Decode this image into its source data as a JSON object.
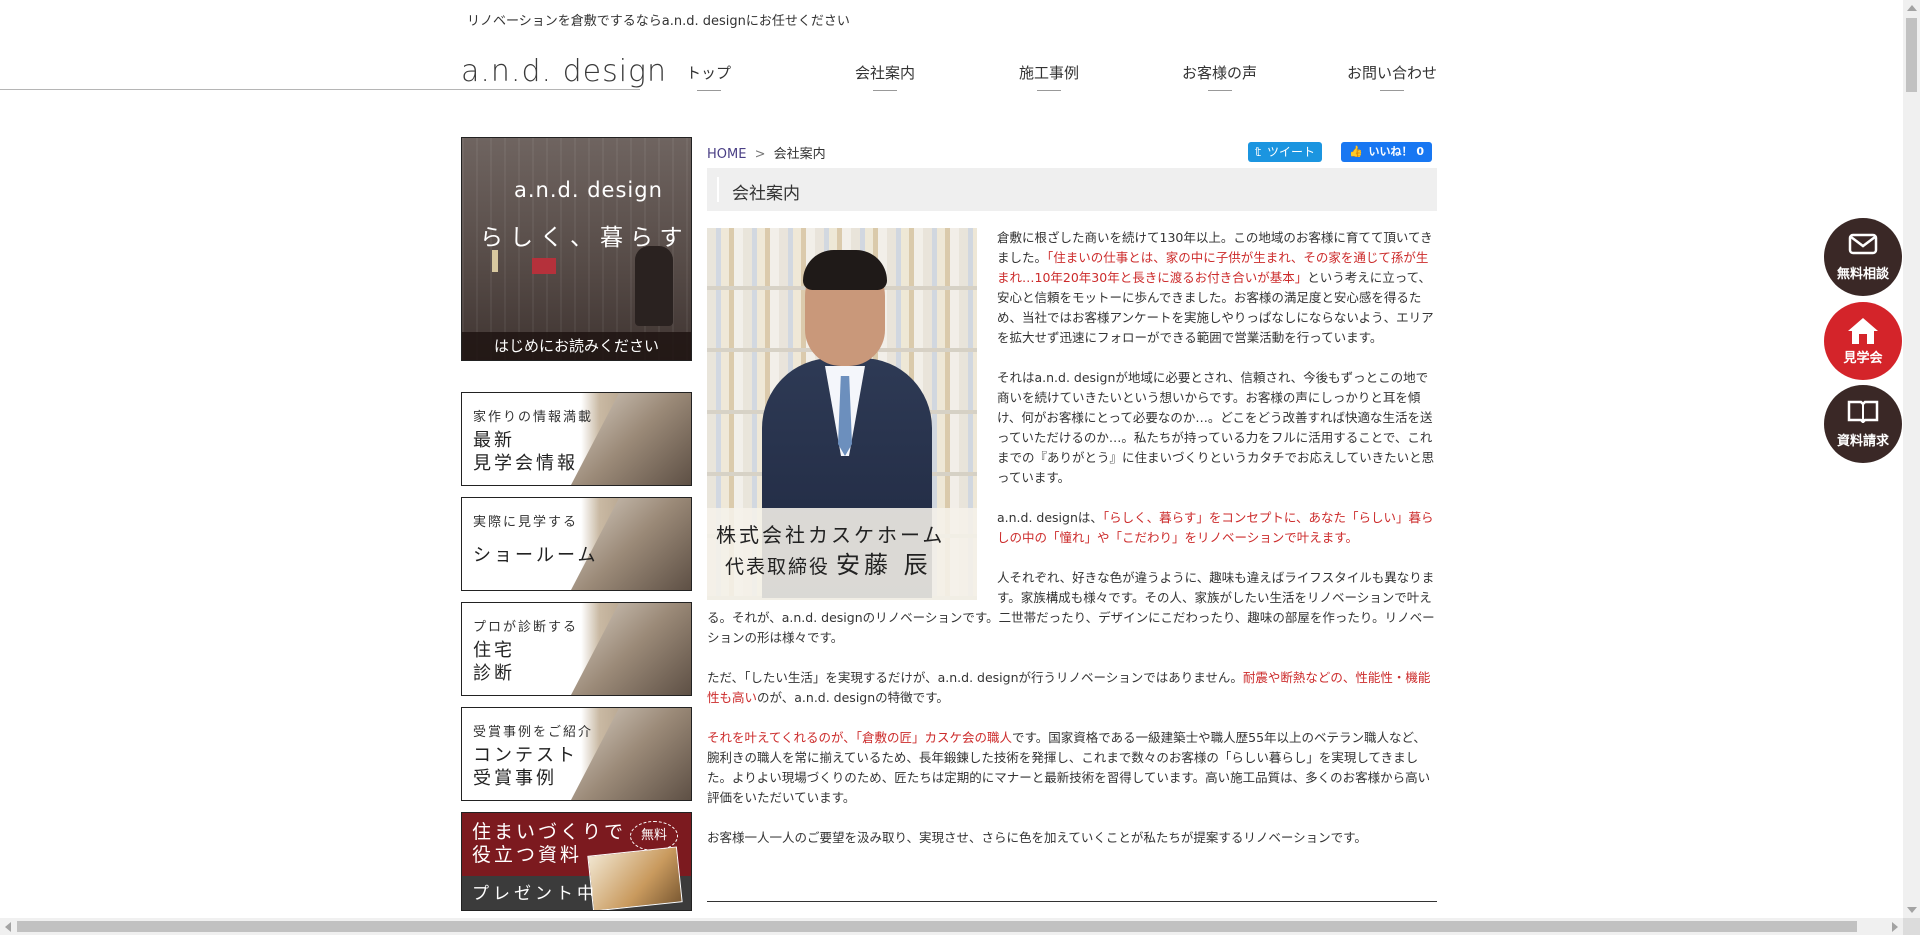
{
  "header": {
    "tagline": "リノベーションを倉敷でするならa.n.d. designにお任せください",
    "logo": "a.n.d. design",
    "nav": [
      "トップ",
      "会社案内",
      "施工事例",
      "お客様の声",
      "お問い合わせ"
    ]
  },
  "sidebar": {
    "hero": {
      "brand": "a.n.d. design",
      "slogan": "らしく、暮らす",
      "readme": "はじめにお読みください"
    },
    "banners": [
      {
        "sub": "家作りの情報満載",
        "main1": "最新",
        "main2": "見学会情報"
      },
      {
        "sub": "実際に見学する",
        "main1": "ショールーム",
        "main2": ""
      },
      {
        "sub": "プロが診断する",
        "main1": "住宅",
        "main2": "診断"
      },
      {
        "sub": "受賞事例をご紹介",
        "main1": "コンテスト",
        "main2": "受賞事例"
      }
    ],
    "gift": {
      "line1a": "住まいづくりで",
      "line1b": "役立つ資料",
      "free": "無料",
      "line2": "プレゼント中"
    }
  },
  "breadcrumb": {
    "home": "HOME",
    "sep": ">",
    "current": "会社案内"
  },
  "social": {
    "tweet": "ツイート",
    "like": "いいね！ 0"
  },
  "main": {
    "title": "会社案内",
    "photo_caption1": "株式会社カスケホーム",
    "photo_caption2_role": "代表取締役",
    "photo_caption2_name": "安藤 辰",
    "p1a": "倉敷に根ざした商いを続けて130年以上。この地域のお客様に育てて頂いてきました。",
    "p1b_red": "「住まいの仕事とは、家の中に子供が生まれ、その家を通じて孫が生まれ…10年20年30年と長きに渡るお付き合いが基本」",
    "p1c": "という考えに立って、安心と信頼をモットーに歩んできました。お客様の満足度と安心感を得るため、当社ではお客様アンケートを実施しやりっぱなしにならないよう、エリアを拡大せず迅速にフォローができる範囲で営業活動を行っています。",
    "p2": "それはa.n.d. designが地域に必要とされ、信頼され、今後もずっとこの地で商いを続けていきたいという想いからです。お客様の声にしっかりと耳を傾け、何がお客様にとって必要なのか…。どこをどう改善すれば快適な生活を送っていただけるのか…。私たちが持っている力をフルに活用することで、これまでの『ありがとう』に住まいづくりというカタチでお応えしていきたいと思っています。",
    "p3a": "a.n.d. designは、",
    "p3b_red": "「らしく、暮らす」をコンセプトに、あなた「らしい」暮らしの中の「憧れ」や「こだわり」をリノベーションで叶えます。",
    "p4": "人それぞれ、好きな色が違うように、趣味も違えばライフスタイルも異なります。家族構成も様々です。その人、家族がしたい生活をリノベーションで叶える。それが、a.n.d. designのリノベーションです。二世帯だったり、デザインにこだわったり、趣味の部屋を作ったり。リノベーションの形は様々です。",
    "p5a": "ただ、「したい生活」を実現するだけが、a.n.d. designが行うリノベーションではありません。",
    "p5b_red": "耐震や断熱などの、性能性・機能性も高い",
    "p5c": "のが、a.n.d. designの特徴です。",
    "p6a_red": "それを叶えてくれるのが、「倉敷の匠」カスケ会の職人",
    "p6b": "です。国家資格である一級建築士や職人歴55年以上のベテラン職人など、腕利きの職人を常に揃えているため、長年鍛錬した技術を発揮し、これまで数々のお客様の「らしい暮らし」を実現してきました。よりよい現場づくりのため、匠たちは定期的にマナーと最新技術を習得しています。高い施工品質は、多くのお客様から高い評価をいただいています。",
    "p7": "お客様一人一人のご要望を汲み取り、実現させ、さらに色を加えていくことが私たちが提案するリノベーションです。"
  },
  "floating": {
    "consult": "無料相談",
    "tour": "見学会",
    "docs": "資料請求"
  },
  "colors": {
    "accent_red": "#cc2b2b",
    "dark_brown": "#3a2826",
    "button_red": "#d4242a",
    "twitter": "#1b95e0",
    "facebook": "#1877f2"
  }
}
